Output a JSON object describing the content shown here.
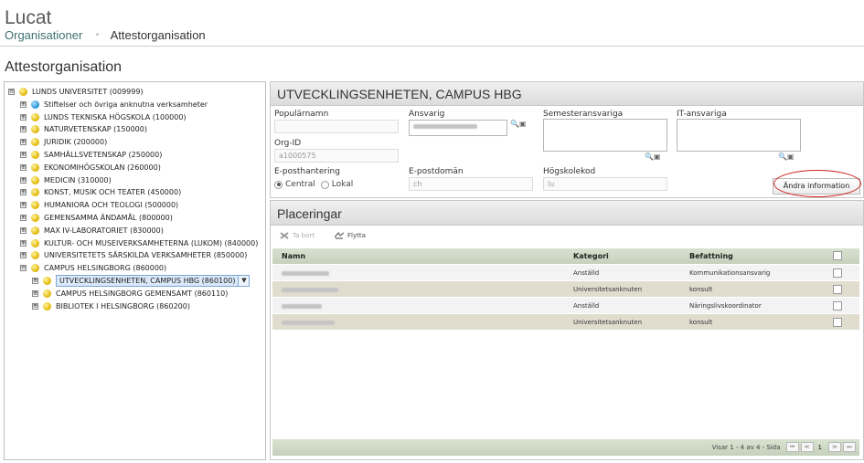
{
  "app": {
    "title": "Lucat"
  },
  "breadcrumb": {
    "items": [
      "Organisationer",
      "Attestorganisation"
    ],
    "separator": "‣"
  },
  "page": {
    "title": "Attestorganisation"
  },
  "tree": {
    "nodes": [
      {
        "label": "LUNDS UNIVERSITET (009999)",
        "icon": "yellow-sphere-icon",
        "expander": "⊟"
      },
      {
        "label": "Stiftelser och övriga anknutna verksamheter",
        "icon": "blue-sphere-icon",
        "expander": "⊞"
      },
      {
        "label": "LUNDS TEKNISKA HÖGSKOLA (100000)",
        "icon": "yellow-sphere-icon",
        "expander": "⊞"
      },
      {
        "label": "NATURVETENSKAP (150000)",
        "icon": "yellow-sphere-icon",
        "expander": "⊞"
      },
      {
        "label": "JURIDIK (200000)",
        "icon": "yellow-sphere-icon",
        "expander": "⊞"
      },
      {
        "label": "SAMHÄLLSVETENSKAP (250000)",
        "icon": "yellow-sphere-icon",
        "expander": "⊞"
      },
      {
        "label": "EKONOMIHÖGSKOLAN (260000)",
        "icon": "yellow-sphere-icon",
        "expander": "⊞"
      },
      {
        "label": "MEDICIN (310000)",
        "icon": "yellow-sphere-icon",
        "expander": "⊞"
      },
      {
        "label": "KONST, MUSIK OCH TEATER (450000)",
        "icon": "yellow-sphere-icon",
        "expander": "⊞"
      },
      {
        "label": "HUMANIORA OCH TEOLOGI (500000)",
        "icon": "yellow-sphere-icon",
        "expander": "⊞"
      },
      {
        "label": "GEMENSAMMA ÄNDAMÅL (800000)",
        "icon": "yellow-sphere-icon",
        "expander": "⊞"
      },
      {
        "label": "MAX IV-LABORATORIET (830000)",
        "icon": "yellow-sphere-icon",
        "expander": "⊞"
      },
      {
        "label": "KULTUR- OCH MUSEIVERKSAMHETERNA (LUKOM) (840000)",
        "icon": "yellow-sphere-icon",
        "expander": "⊞"
      },
      {
        "label": "UNIVERSITETETS SÄRSKILDA VERKSAMHETER (850000)",
        "icon": "yellow-sphere-icon",
        "expander": "⊞"
      },
      {
        "label": "CAMPUS HELSINGBORG (860000)",
        "icon": "yellow-sphere-icon",
        "expander": "⊟"
      },
      {
        "label": "UTVECKLINGSENHETEN, CAMPUS HBG (860100)",
        "icon": "yellow-sphere-icon",
        "expander": "⊞",
        "selected": true,
        "dropdown": "▼"
      },
      {
        "label": "CAMPUS HELSINGBORG GEMENSAMT (860110)",
        "icon": "yellow-sphere-icon",
        "expander": "⊞"
      },
      {
        "label": "BIBLIOTEK I HELSINGBORG (860200)",
        "icon": "yellow-sphere-icon",
        "expander": "⊞"
      }
    ]
  },
  "detail": {
    "title": "UTVECKLINGSENHETEN, CAMPUS HBG",
    "fields": {
      "popularnamn": {
        "label": "Populärnamn",
        "value": ""
      },
      "ansvarig": {
        "label": "Ansvarig"
      },
      "semesteransvariga": {
        "label": "Semesteransvariga"
      },
      "itansvariga": {
        "label": "IT-ansvariga"
      },
      "orgid": {
        "label": "Org-ID",
        "value": "a1000575"
      },
      "eposthantering": {
        "label": "E-posthantering",
        "options": [
          "Central",
          "Lokal"
        ],
        "selected": "Central"
      },
      "epostdoman": {
        "label": "E-postdomän",
        "value": "ch"
      },
      "hogskolekod": {
        "label": "Högskolekod",
        "value": "lu"
      }
    },
    "edit_button": "Ändra information",
    "annotation_color": "#d02020"
  },
  "placeringar": {
    "title": "Placeringar",
    "toolbar": {
      "remove": "Ta bort",
      "move": "Flytta"
    },
    "columns": [
      "Namn",
      "Kategori",
      "Befattning"
    ],
    "rows": [
      {
        "kategori": "Anställd",
        "befattning": "Kommunikationsansvarig"
      },
      {
        "kategori": "Universitetsanknuten",
        "befattning": "konsult"
      },
      {
        "kategori": "Anställd",
        "befattning": "Näringslivskoordinator"
      },
      {
        "kategori": "Universitetsanknuten",
        "befattning": "konsult"
      }
    ],
    "footer": {
      "status": "Visar 1 - 4 av 4 - Sida",
      "page": "1",
      "pager_buttons": [
        "⏮",
        "≪",
        "≫",
        "⏭"
      ]
    }
  },
  "colors": {
    "accent": "#3f6f6f",
    "header_bg": "#dcdcdc",
    "grid_header": "#c5d1bc",
    "row_alt": "#e0ddcf"
  }
}
